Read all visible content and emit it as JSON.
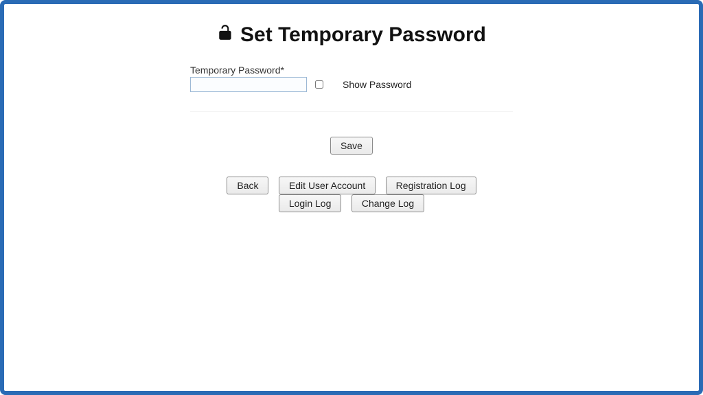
{
  "title": "Set Temporary Password",
  "form": {
    "password_label": "Temporary Password*",
    "password_value": "",
    "show_password_label": "Show Password"
  },
  "actions": {
    "save": "Save"
  },
  "nav": {
    "back": "Back",
    "edit_user": "Edit User Account",
    "registration_log": "Registration Log",
    "login_log": "Login Log",
    "change_log": "Change Log"
  }
}
